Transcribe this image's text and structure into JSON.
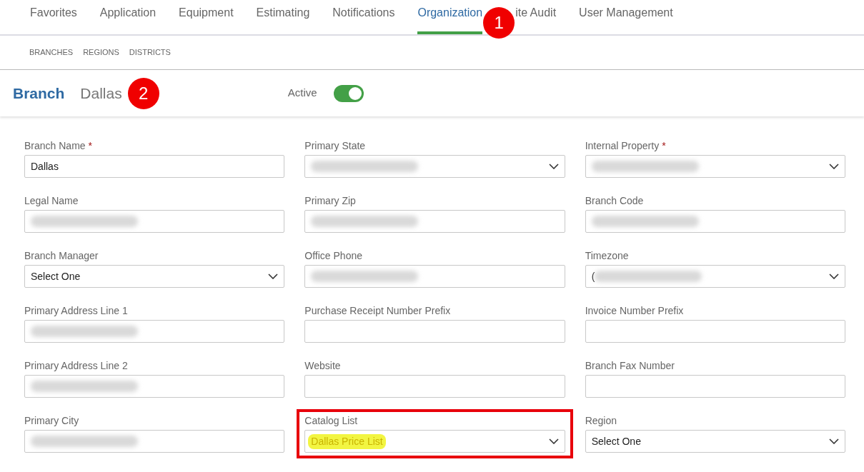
{
  "tabs": [
    {
      "label": "Favorites",
      "selected": false
    },
    {
      "label": "Application",
      "selected": false
    },
    {
      "label": "Equipment",
      "selected": false
    },
    {
      "label": "Estimating",
      "selected": false
    },
    {
      "label": "Notifications",
      "selected": false
    },
    {
      "label": "Organization",
      "selected": true
    },
    {
      "label": "ite Audit",
      "selected": false
    },
    {
      "label": "User Management",
      "selected": false
    }
  ],
  "subtabs": [
    {
      "label": "BRANCHES"
    },
    {
      "label": "REGIONS"
    },
    {
      "label": "DISTRICTS"
    }
  ],
  "header": {
    "title": "Branch",
    "name": "Dallas",
    "active_label": "Active",
    "active": true
  },
  "fields": [
    {
      "label": "Branch Name",
      "required_mark": "*",
      "kind": "text",
      "value": "Dallas"
    },
    {
      "label": "Primary State",
      "kind": "select",
      "redacted": true
    },
    {
      "label": "Internal Property",
      "required_mark": "*",
      "kind": "select",
      "redacted": true
    },
    {
      "label": "Legal Name",
      "kind": "text",
      "redacted": true
    },
    {
      "label": "Primary Zip",
      "kind": "text",
      "redacted": true
    },
    {
      "label": "Branch Code",
      "kind": "text",
      "redacted": true
    },
    {
      "label": "Branch Manager",
      "kind": "select",
      "value": "Select One"
    },
    {
      "label": "Office Phone",
      "kind": "text",
      "redacted": true
    },
    {
      "label": "Timezone",
      "kind": "select",
      "value": "(",
      "redacted": true
    },
    {
      "label": "Primary Address Line 1",
      "kind": "text",
      "redacted": true
    },
    {
      "label": "Purchase Receipt Number Prefix",
      "kind": "text"
    },
    {
      "label": "Invoice Number Prefix",
      "kind": "text"
    },
    {
      "label": "Primary Address Line 2",
      "kind": "text",
      "redacted": true
    },
    {
      "label": "Website",
      "kind": "text"
    },
    {
      "label": "Branch Fax Number",
      "kind": "text"
    },
    {
      "label": "Primary City",
      "kind": "text",
      "redacted": true
    },
    {
      "label": "Catalog List",
      "kind": "select",
      "value": "Dallas Price List",
      "highlighted": true
    },
    {
      "label": "Region",
      "kind": "select",
      "value": "Select One"
    }
  ],
  "callouts": [
    {
      "label": "1"
    },
    {
      "label": "2"
    }
  ]
}
